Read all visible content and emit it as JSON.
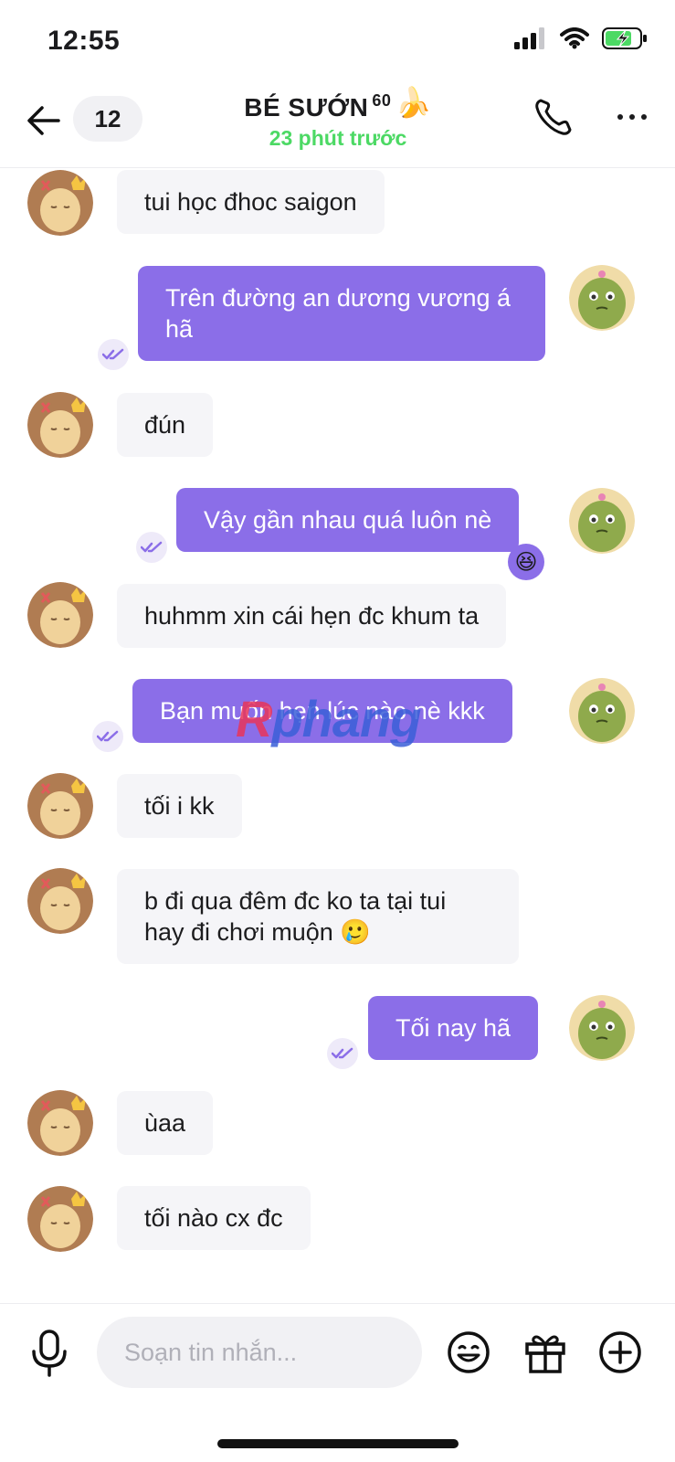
{
  "status_bar": {
    "time": "12:55"
  },
  "header": {
    "unread_count": "12",
    "title": "BÉ SƯỚN",
    "title_sup": "60",
    "title_emoji": "🍌",
    "subtitle": "23 phút trước",
    "subtitle_color": "#4cd964"
  },
  "messages": [
    {
      "from": "them",
      "text": "tui học đhoc saigon"
    },
    {
      "from": "me",
      "text": "Trên đường an dương vương á hã",
      "status": "seen"
    },
    {
      "from": "them",
      "text": "đún"
    },
    {
      "from": "me",
      "text": "Vậy gần nhau quá luôn nè",
      "status": "seen",
      "reaction": "😆"
    },
    {
      "from": "them",
      "text": "huhmm xin cái hẹn đc khum ta"
    },
    {
      "from": "me",
      "text": "Bạn muốn hẹn lúc nào nè kkk",
      "status": "seen"
    },
    {
      "from": "them",
      "text": "tối i kk"
    },
    {
      "from": "them",
      "text": "b đi qua đêm đc ko ta tại tui hay đi chơi muộn 🥲"
    },
    {
      "from": "me",
      "text": "Tối nay hã",
      "status": "seen"
    },
    {
      "from": "them",
      "text": "ùaa"
    },
    {
      "from": "them",
      "text": "tối nào cx đc"
    }
  ],
  "watermark": {
    "part1": "R",
    "part2": "phang"
  },
  "composer": {
    "placeholder": "Soạn tin nhắn..."
  },
  "icons": {
    "back": "arrow-left-icon",
    "call": "phone-icon",
    "more": "more-dots-icon",
    "mic": "microphone-icon",
    "emoji": "emoji-icon",
    "gift": "gift-icon",
    "plus": "plus-circle-icon",
    "seen": "double-check-icon"
  },
  "colors": {
    "outgoing_bubble": "#8b6ee8",
    "incoming_bubble": "#f5f5f8",
    "online_text": "#4cd964"
  }
}
